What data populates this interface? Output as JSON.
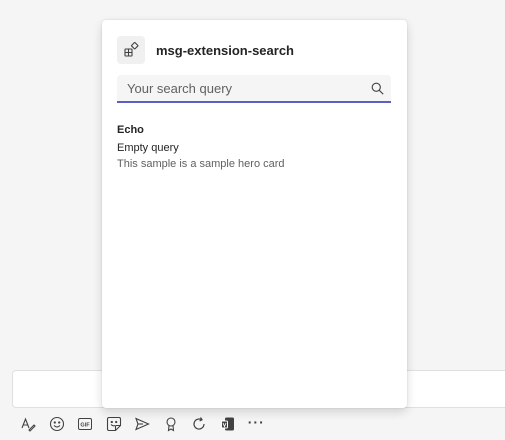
{
  "flyout": {
    "app_title": "msg-extension-search",
    "app_icon": "apps-icon",
    "search": {
      "placeholder": "Your search query",
      "value": "",
      "icon": "search-icon"
    },
    "results": {
      "section_title": "Echo",
      "items": [
        {
          "title": "Empty query",
          "description": "This sample is a sample hero card"
        }
      ]
    }
  },
  "toolbar": {
    "buttons": [
      "format-icon",
      "emoji-icon",
      "gif-icon",
      "sticker-icon",
      "send-icon",
      "praise-icon",
      "loop-icon",
      "app-icon"
    ],
    "gif_label": "GIF",
    "more_label": "···"
  },
  "colors": {
    "accent": "#5b5fc7",
    "background": "#f5f5f5"
  }
}
